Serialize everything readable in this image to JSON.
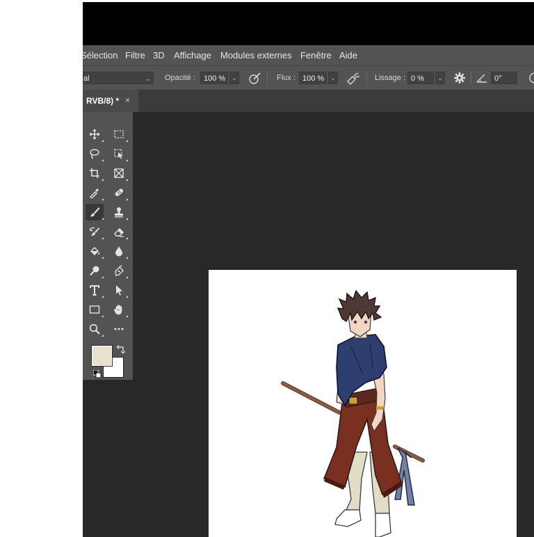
{
  "menu": [
    "Sélection",
    "Filtre",
    "3D",
    "Affichage",
    "Modules externes",
    "Fenêtre",
    "Aide"
  ],
  "options": {
    "mode_value": "al",
    "opacity_label": "Opacité :",
    "opacity_value": "100 %",
    "flux_label": "Flux :",
    "flux_value": "100 %",
    "smoothing_label": "Lissage :",
    "smoothing_value": "0 %",
    "angle_value": "0°"
  },
  "tab": {
    "label": "RVB/8) *",
    "close": "×"
  },
  "tools": [
    {
      "row": 0,
      "col": 0,
      "icon": "move-icon"
    },
    {
      "row": 0,
      "col": 1,
      "icon": "marquee-icon"
    },
    {
      "row": 1,
      "col": 0,
      "icon": "lasso-icon"
    },
    {
      "row": 1,
      "col": 1,
      "icon": "object-selection-icon"
    },
    {
      "row": 2,
      "col": 0,
      "icon": "crop-icon"
    },
    {
      "row": 2,
      "col": 1,
      "icon": "frame-icon"
    },
    {
      "row": 3,
      "col": 0,
      "icon": "eyedropper-icon"
    },
    {
      "row": 3,
      "col": 1,
      "icon": "healing-brush-icon"
    },
    {
      "row": 4,
      "col": 0,
      "icon": "brush-icon",
      "active": true
    },
    {
      "row": 4,
      "col": 1,
      "icon": "stamp-icon"
    },
    {
      "row": 5,
      "col": 0,
      "icon": "history-brush-icon"
    },
    {
      "row": 5,
      "col": 1,
      "icon": "eraser-icon"
    },
    {
      "row": 6,
      "col": 0,
      "icon": "paint-bucket-icon"
    },
    {
      "row": 6,
      "col": 1,
      "icon": "blur-icon"
    },
    {
      "row": 7,
      "col": 0,
      "icon": "dodge-icon"
    },
    {
      "row": 7,
      "col": 1,
      "icon": "pen-icon"
    },
    {
      "row": 8,
      "col": 0,
      "icon": "type-icon"
    },
    {
      "row": 8,
      "col": 1,
      "icon": "path-selection-icon"
    },
    {
      "row": 9,
      "col": 0,
      "icon": "rectangle-icon"
    },
    {
      "row": 9,
      "col": 1,
      "icon": "hand-icon"
    },
    {
      "row": 10,
      "col": 0,
      "icon": "zoom-icon"
    },
    {
      "row": 10,
      "col": 1,
      "icon": "more-tools-icon"
    }
  ],
  "colors": {
    "foreground": "#e6e2cf",
    "background": "#ffffff",
    "workspace": "#282828",
    "panel": "#535353",
    "scarf": "#2e3e6e",
    "robe": "#7a3020",
    "hair": "#4e3a35",
    "staff": "#8b5a44"
  }
}
